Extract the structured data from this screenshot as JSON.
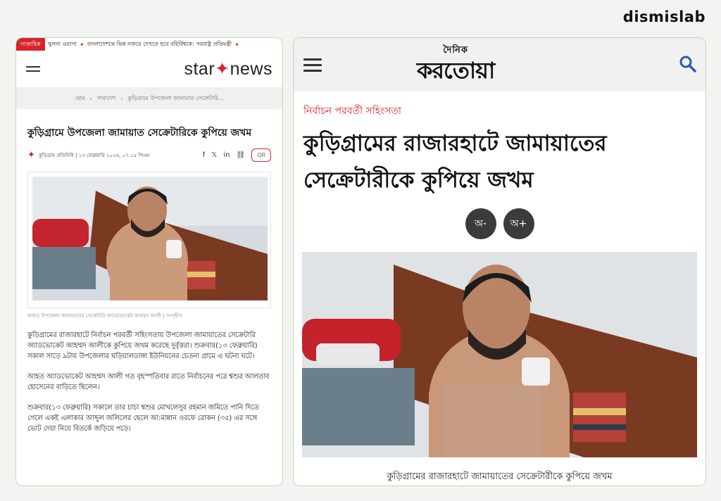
{
  "brand": "dismislab",
  "left": {
    "ticker": {
      "tag": "সাপ্তাহিক",
      "items": [
        "খুলনা ওয়াসা",
        "বাংলাদেশকে ভিন্ন নজরে দেখতে হবে বহির্বিশ্বকে: পররাষ্ট্র প্রতিমন্ত্রী"
      ]
    },
    "logo_a": "star",
    "logo_b": "news",
    "breadcrumb": [
      "হোম",
      "সারাদেশ",
      "কুড়িগ্রামে উপজেলা জামায়াত সেক্রেটারি..."
    ],
    "title": "কুড়িগ্রামে উপজেলা জামায়াত সেক্রেটারিকে কুপিয়ে জখম",
    "byline": "কুড়িগ্রাম প্রতিনিধি | ১৩ ফেব্রুয়ারি ২০২৬, ০৭:১৫ পিএম",
    "qr": "QR",
    "caption": "আহত উপজেলা জামায়াতের সেক্রেটারি অ্যাডভোকেট আহম্মদ আলী | সংগৃহীত",
    "paragraphs": [
      "কুড়িগ্রামের রাজারহাটে নির্বাচন পরবর্তী সহিংসতায় উপজেলা জামায়াতের সেক্রেটারি অ্যাডভোকেট আহম্মদ আলীকে কুপিয়ে জখম করেছে দুর্বৃত্তরা। শুক্রবার(১৩ ফেব্রুয়ারি) সকাল সাড়ে ৯টায় উপজেলার ঘড়িয়ালডাঙ্গা ইউনিয়নের চেতনা গ্রামে এ ঘটনা ঘটে।",
      "আহত অ্যাডভোকেট আহম্মদ আলী গত বৃহস্পতিবার রাতে নির্বাচনের পরে শ্বশুর আলতাব হোসেনের বাড়িতে ছিলেন।",
      "শুক্রবার(১৩ ফেব্রুয়ারি) সকালে তার চাচা শ্বশুর মোখলেসুর রহমান জমিতে পানি দিতে গেলে একই এলাকার আব্দুল জলিলের ছেলে আ:মান্নান ওরফে রোকন (৩৫) এর সঙ্গে ভোট দেয়া নিয়ে বিতর্কে জড়িয়ে পড়ে।"
    ]
  },
  "right": {
    "logo_small": "দৈনিক",
    "logo_big": "করতোয়া",
    "category": "নির্বাচন পরবর্তী সহিংসতা",
    "title": "কুড়িগ্রামের রাজারহাটে জামায়াতের সেক্রেটারীকে কুপিয়ে জখম",
    "font_minus": "অ-",
    "font_plus": "অ+",
    "caption": "কুড়িগ্রামের রাজারহাটে জামায়াতের সেক্রেটারীকে কুপিয়ে জখম"
  },
  "colors": {
    "accent": "#d7242a",
    "border": "#b9ddb0",
    "button": "#3b3b3b",
    "search": "#2a5ba8"
  }
}
